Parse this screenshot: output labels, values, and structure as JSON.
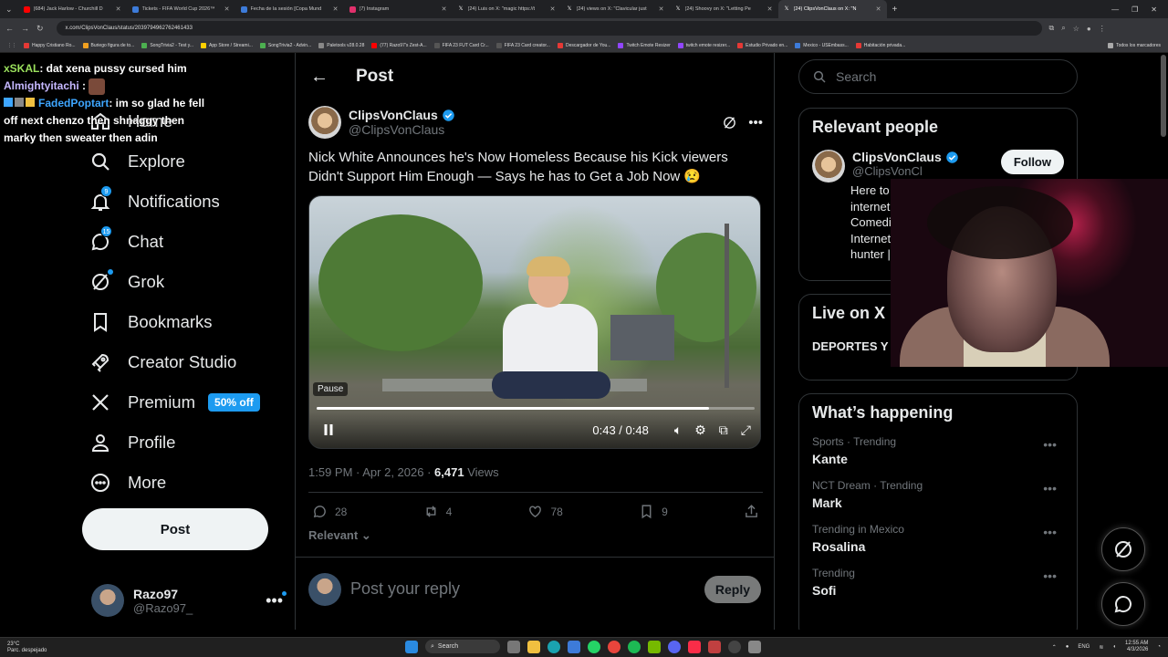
{
  "browser": {
    "tabs": [
      {
        "label": "(684) Jack Harlow - Churchill D",
        "color": "#ff0000"
      },
      {
        "label": "Tickets - FIFA World Cup 2026™",
        "color": "#3d7bd9"
      },
      {
        "label": "Fecha de la sesión [Copa Mund",
        "color": "#3d7bd9"
      },
      {
        "label": "(7) Instagram",
        "color": "#e1306c"
      },
      {
        "label": "(24) Luis on X: \"magic https://t",
        "color": "#000000"
      },
      {
        "label": "(24) views on X: \"Clavicular just",
        "color": "#000000"
      },
      {
        "label": "(24) Shoovy on X: \"Letting Pe",
        "color": "#000000"
      },
      {
        "label": "(24) ClipsVonClaus on X: \"N",
        "color": "#000000",
        "active": true
      }
    ],
    "url": "x.com/ClipsVonClaus/status/2039794962762461433",
    "bookmarks": [
      {
        "label": "Happy Cristiano Ro...",
        "color": "#e53935"
      },
      {
        "label": "Buriego figura de to...",
        "color": "#f0a020"
      },
      {
        "label": "SongTrivia2 - Test y...",
        "color": "#4caf50"
      },
      {
        "label": "App Store / Streami...",
        "color": "#ffd000"
      },
      {
        "label": "SongTrivia2 - Advin...",
        "color": "#4caf50"
      },
      {
        "label": "Paletools v28.0.28",
        "color": "#888888"
      },
      {
        "label": "(77) Razo97's Zest-A...",
        "color": "#ff0000"
      },
      {
        "label": "FIFA 23 FUT Card Cr...",
        "color": "#555555"
      },
      {
        "label": "FIFA 23 Card creator...",
        "color": "#555555"
      },
      {
        "label": "Descargador de You...",
        "color": "#e53935"
      },
      {
        "label": "Twitch Emote Resizer",
        "color": "#9146ff"
      },
      {
        "label": "twitch emote resizer...",
        "color": "#9146ff"
      },
      {
        "label": "Estudio Privado en...",
        "color": "#e53935"
      },
      {
        "label": "Mexico - USEmbass...",
        "color": "#3d7bd9"
      },
      {
        "label": "Habitación privada...",
        "color": "#e53935"
      }
    ],
    "all_bookmarks": "Todos los marcadores"
  },
  "chat": [
    {
      "user": "xSKAL",
      "text": ": dat xena pussy cursed him"
    },
    {
      "user": "Almightyitachi",
      "text": ":"
    },
    {
      "user": "FadedPoptart",
      "text": ": im so glad he fell off next chenzo then shnaggy then marky then sweater then adin"
    }
  ],
  "nav": {
    "items": [
      {
        "label": "Home",
        "icon": "home-icon"
      },
      {
        "label": "Explore",
        "icon": "search-icon"
      },
      {
        "label": "Notifications",
        "icon": "bell-icon",
        "badge": "9"
      },
      {
        "label": "Chat",
        "icon": "chat-icon",
        "badge": "15"
      },
      {
        "label": "Grok",
        "icon": "grok-icon"
      },
      {
        "label": "Bookmarks",
        "icon": "bookmark-icon"
      },
      {
        "label": "Creator Studio",
        "icon": "rocket-icon"
      },
      {
        "label": "Premium",
        "icon": "x-logo-icon",
        "promo": "50% off"
      },
      {
        "label": "Profile",
        "icon": "person-icon"
      },
      {
        "label": "More",
        "icon": "more-circle-icon"
      }
    ],
    "post_button": "Post",
    "account": {
      "name": "Razo97",
      "handle": "@Razo97_"
    }
  },
  "main": {
    "header": "Post",
    "tweet": {
      "author": "ClipsVonClaus",
      "handle": "@ClipsVonClaus",
      "text": "Nick White Announces he's Now Homeless Because his Kick viewers Didn't Support Him Enough — Says he has to Get a Job Now 😢",
      "video": {
        "tooltip": "Pause",
        "time": "0:43 / 0:48",
        "progress": 0.896
      },
      "timestamp": "1:59 PM · Apr 2, 2026 · ",
      "views_count": "6,471",
      "views_label": " Views",
      "stats": {
        "replies": "28",
        "reposts": "4",
        "likes": "78",
        "bookmarks": "9"
      },
      "sort": "Relevant"
    },
    "reply": {
      "placeholder": "Post your reply",
      "button": "Reply"
    }
  },
  "sidebar": {
    "search_placeholder": "Search",
    "relevant_people": {
      "title": "Relevant people",
      "name": "ClipsVonClaus",
      "handle": "@ClipsVonCl",
      "follow": "Follow",
      "bio": "Here to internet Comedi Internet hunter |"
    },
    "live": {
      "title": "Live on X",
      "item": "DEPORTES Y M"
    },
    "happening": {
      "title": "What’s happening",
      "trends": [
        {
          "category": "Sports · Trending",
          "name": "Kante"
        },
        {
          "category": "NCT Dream · Trending",
          "name": "Mark"
        },
        {
          "category": "Trending in Mexico",
          "name": "Rosalina"
        },
        {
          "category": "Trending",
          "name": "Sofi"
        }
      ]
    }
  },
  "taskbar": {
    "weather_temp": "23°C",
    "weather_desc": "Parc. despejado",
    "search": "Search",
    "lang": "ENG",
    "time": "12:55 AM",
    "date": "4/3/2026"
  }
}
